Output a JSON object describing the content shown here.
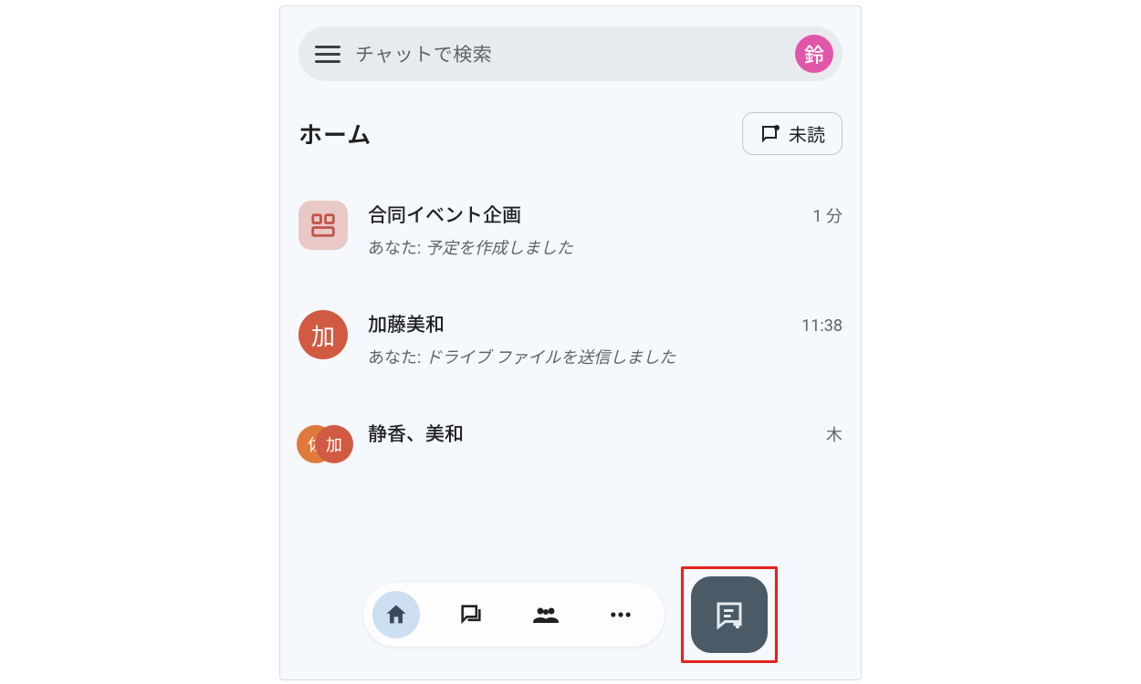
{
  "search": {
    "placeholder": "チャットで検索",
    "avatar_initial": "鈴"
  },
  "section": {
    "title": "ホーム",
    "unread_label": "未読"
  },
  "chats": [
    {
      "title": "合同イベント企画",
      "preview_prefix": "あなた: ",
      "preview_body": "予定を作成しました",
      "preview_italic": true,
      "time": "1 分",
      "avatar_type": "space",
      "avatar_text": ""
    },
    {
      "title": "加藤美和",
      "preview_prefix": "あなた: ",
      "preview_body": "ドライブ ファイルを送信しました",
      "preview_italic": true,
      "time": "11:38",
      "avatar_type": "circle-red",
      "avatar_text": "加"
    },
    {
      "title": "静香、美和",
      "preview_prefix": "",
      "preview_body": "",
      "preview_italic": false,
      "time": "木",
      "avatar_type": "group",
      "avatar_text_a": "佐",
      "avatar_text_b": "加"
    }
  ],
  "nav": {
    "home": "home",
    "chat": "chat",
    "spaces": "spaces",
    "more": "more"
  }
}
